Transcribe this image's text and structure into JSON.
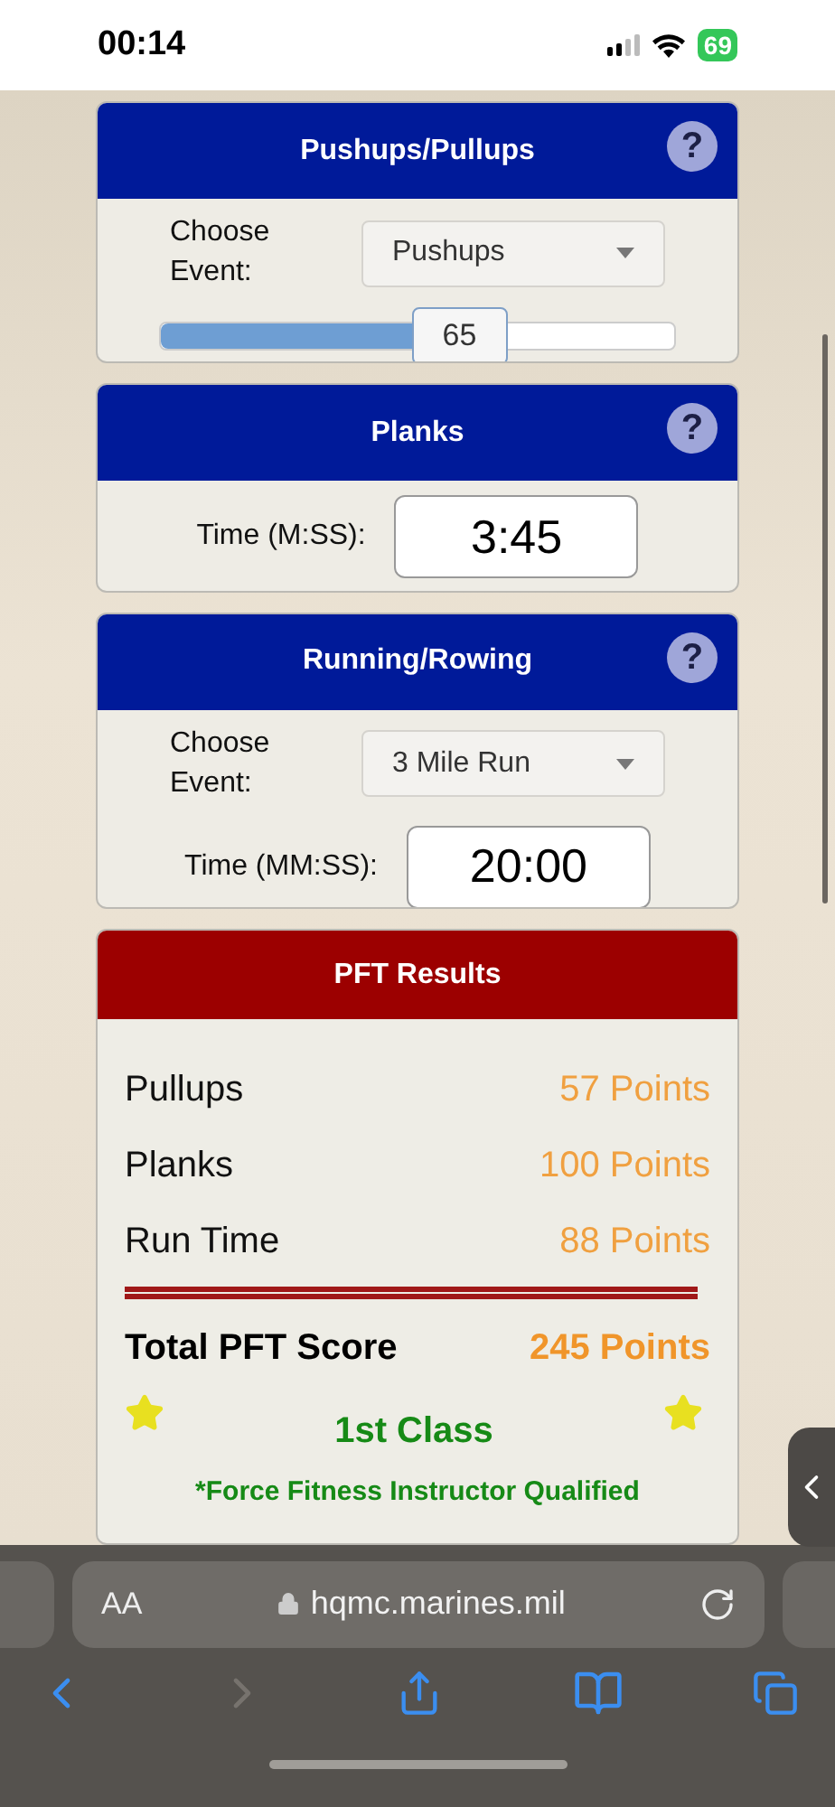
{
  "status_bar": {
    "time": "00:14",
    "battery": "69"
  },
  "sections": [
    {
      "title": "Pushups/Pullups",
      "help": "?",
      "rows": [
        {
          "kind": "select",
          "label": "Choose Event:",
          "value": "Pushups"
        },
        {
          "kind": "slider",
          "value": "65",
          "level": 0.58
        }
      ]
    },
    {
      "title": "Planks",
      "help": "?",
      "rows": [
        {
          "kind": "time",
          "label": "Time (M:SS):",
          "value": "3:45"
        }
      ]
    },
    {
      "title": "Running/Rowing",
      "help": "?",
      "rows": [
        {
          "kind": "select",
          "label": "Choose Event:",
          "value": "3 Mile Run"
        },
        {
          "kind": "time",
          "label": "Time (MM:SS):",
          "value": "20:00"
        }
      ]
    }
  ],
  "results": {
    "title": "PFT Results",
    "rows": [
      {
        "label": "Pullups",
        "points": "57 Points"
      },
      {
        "label": "Planks",
        "points": "100 Points"
      },
      {
        "label": "Run Time",
        "points": "88 Points"
      }
    ],
    "total": {
      "label": "Total PFT Score",
      "points": "245 Points"
    },
    "class": "1st Class",
    "note": "*Force Fitness Instructor Qualified"
  },
  "browser": {
    "text_size": "AA",
    "url": "hqmc.marines.mil",
    "back": {
      "disabled": false
    },
    "forward": {
      "disabled": true
    }
  }
}
